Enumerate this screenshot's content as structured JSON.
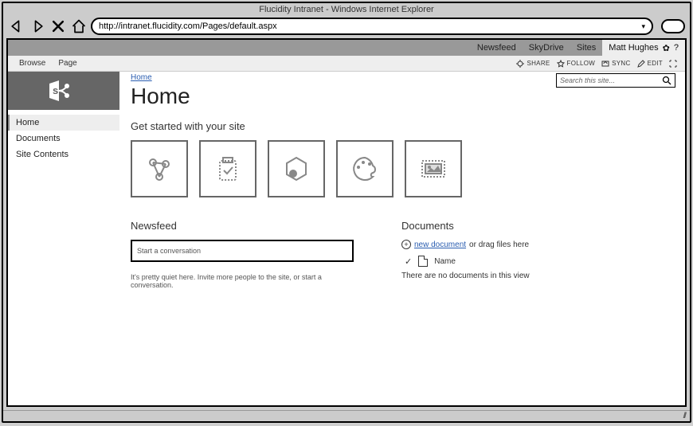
{
  "window": {
    "title": "Flucidity Intranet - Windows Internet Explorer"
  },
  "browser": {
    "url": "http://intranet.flucidity.com/Pages/default.aspx"
  },
  "topnav": {
    "newsfeed": "Newsfeed",
    "skydrive": "SkyDrive",
    "sites": "Sites"
  },
  "user": {
    "name": "Matt Hughes"
  },
  "ribbon": {
    "tabs": {
      "browse": "Browse",
      "page": "Page"
    },
    "actions": {
      "share": "SHARE",
      "follow": "FOLLOW",
      "sync": "SYNC",
      "edit": "EDIT"
    }
  },
  "sidebar": {
    "items": [
      "Home",
      "Documents",
      "Site Contents"
    ]
  },
  "breadcrumb": {
    "home": "Home"
  },
  "page": {
    "title": "Home",
    "get_started": "Get started with your site"
  },
  "search": {
    "placeholder": "Search this site..."
  },
  "newsfeed": {
    "heading": "Newsfeed",
    "placeholder": "Start a conversation",
    "empty": "It's pretty quiet here. Invite more people to the site, or start a conversation."
  },
  "documents": {
    "heading": "Documents",
    "new_doc": "new document",
    "drag_hint": " or drag files here",
    "col_name": "Name",
    "empty": "There are no documents in this view"
  }
}
